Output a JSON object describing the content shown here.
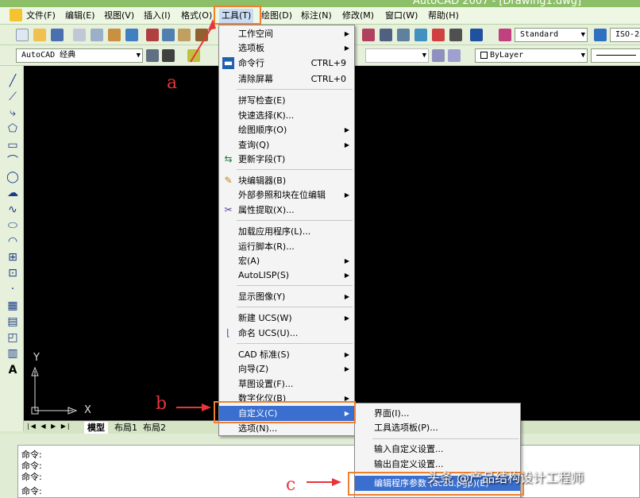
{
  "window": {
    "title": "AutoCAD 2007 - [Drawing1.dwg]"
  },
  "menubar": [
    {
      "label": "文件(F)"
    },
    {
      "label": "编辑(E)"
    },
    {
      "label": "视图(V)"
    },
    {
      "label": "插入(I)"
    },
    {
      "label": "格式(O)"
    },
    {
      "label": "工具(T)"
    },
    {
      "label": "绘图(D)"
    },
    {
      "label": "标注(N)"
    },
    {
      "label": "修改(M)"
    },
    {
      "label": "窗口(W)"
    },
    {
      "label": "帮助(H)"
    }
  ],
  "toolbar": {
    "text_style": "Standard",
    "dim_style": "ISO-25",
    "workspace": "AutoCAD 经典",
    "layer_color": "ByLayer"
  },
  "tools_menu": [
    {
      "label": "工作空间",
      "submenu": true
    },
    {
      "label": "选项板",
      "submenu": true
    },
    {
      "label": "命令行",
      "shortcut": "CTRL+9",
      "icon": "command-line-icon"
    },
    {
      "label": "清除屏幕",
      "shortcut": "CTRL+0"
    },
    {
      "label": "拼写检查(E)"
    },
    {
      "label": "快速选择(K)..."
    },
    {
      "label": "绘图顺序(O)",
      "submenu": true
    },
    {
      "label": "查询(Q)",
      "submenu": true
    },
    {
      "label": "更新字段(T)",
      "icon": "update-field-icon"
    },
    {
      "label": "块编辑器(B)",
      "icon": "block-editor-icon"
    },
    {
      "label": "外部参照和块在位编辑",
      "submenu": true
    },
    {
      "label": "属性提取(X)...",
      "icon": "attribute-extract-icon"
    },
    {
      "label": "加载应用程序(L)..."
    },
    {
      "label": "运行脚本(R)..."
    },
    {
      "label": "宏(A)",
      "submenu": true
    },
    {
      "label": "AutoLISP(S)",
      "submenu": true
    },
    {
      "label": "显示图像(Y)",
      "submenu": true
    },
    {
      "label": "新建 UCS(W)",
      "submenu": true
    },
    {
      "label": "命名 UCS(U)...",
      "icon": "named-ucs-icon"
    },
    {
      "label": "CAD 标准(S)",
      "submenu": true
    },
    {
      "label": "向导(Z)",
      "submenu": true
    },
    {
      "label": "草图设置(F)..."
    },
    {
      "label": "数字化仪(B)",
      "submenu": true
    },
    {
      "label": "自定义(C)",
      "submenu": true
    },
    {
      "label": "选项(N)..."
    }
  ],
  "customize_submenu": [
    {
      "label": "界面(I)..."
    },
    {
      "label": "工具选项板(P)..."
    },
    {
      "label": "输入自定义设置..."
    },
    {
      "label": "输出自定义设置..."
    },
    {
      "label": "编辑程序参数 (acad.pgp)(E)"
    }
  ],
  "layout_tabs": [
    {
      "label": "模型"
    },
    {
      "label": "布局1"
    },
    {
      "label": "布局2"
    }
  ],
  "command_lines": [
    "命令:",
    "命令:",
    "命令:",
    "命令:"
  ],
  "annotations": {
    "a": "a",
    "b": "b",
    "c": "c"
  },
  "ucs": {
    "x": "X",
    "y": "Y"
  },
  "watermark": "头条 @产品结构设计工程师",
  "colors": {
    "highlight": "#3a6fd0",
    "annotation": "#e8353a",
    "annotation_box": "#f08030"
  }
}
